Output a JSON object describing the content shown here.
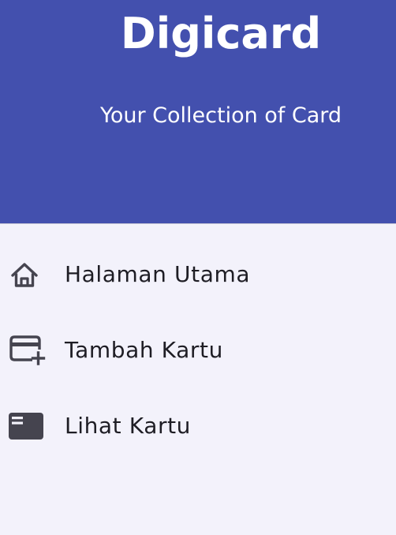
{
  "header": {
    "title": "Digicard",
    "subtitle": "Your Collection of Card",
    "background_color": "#4350ae"
  },
  "menu": {
    "items": [
      {
        "label": "Halaman Utama",
        "icon": "home-icon"
      },
      {
        "label": "Tambah Kartu",
        "icon": "add-card-icon"
      },
      {
        "label": "Lihat Kartu",
        "icon": "view-card-icon"
      }
    ]
  },
  "colors": {
    "drawer_background": "#f3f2fb",
    "text": "#1e1d24",
    "icon": "#45444f"
  }
}
